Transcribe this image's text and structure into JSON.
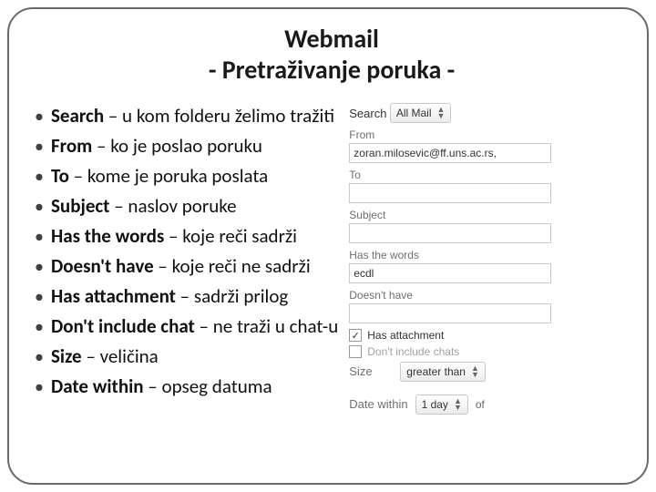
{
  "title_line1": "Webmail",
  "title_line2": "- Pretraživanje poruka -",
  "bullets": [
    {
      "term": "Search",
      "desc": " – u kom folderu želimo tražiti"
    },
    {
      "term": "From",
      "desc": " – ko je poslao poruku"
    },
    {
      "term": "To",
      "desc": " – kome je poruka poslata"
    },
    {
      "term": "Subject",
      "desc": " – naslov poruke"
    },
    {
      "term": "Has the words",
      "desc": " – koje reči sadrži"
    },
    {
      "term": "Doesn't have",
      "desc": " – koje reči ne sadrži"
    },
    {
      "term": "Has attachment",
      "desc": " – sadrži prilog"
    },
    {
      "term": "Don't include chat",
      "desc": " – ne traži u chat-u"
    },
    {
      "term": "Size",
      "desc": " – veličina"
    },
    {
      "term": "Date within",
      "desc": " – opseg datuma"
    }
  ],
  "panel": {
    "search_label": "Search",
    "search_select": "All Mail",
    "from_label": "From",
    "from_value": "zoran.milosevic@ff.uns.ac.rs,",
    "to_label": "To",
    "to_value": "",
    "subject_label": "Subject",
    "subject_value": "",
    "has_words_label": "Has the words",
    "has_words_value": "ecdl",
    "doesnt_have_label": "Doesn't have",
    "doesnt_have_value": "",
    "has_attachment_label": "Has attachment",
    "dont_include_chats_label": "Don't include chats",
    "size_label": "Size",
    "size_select": "greater than",
    "date_within_label": "Date within",
    "date_within_select": "1 day",
    "of_label": "of"
  }
}
